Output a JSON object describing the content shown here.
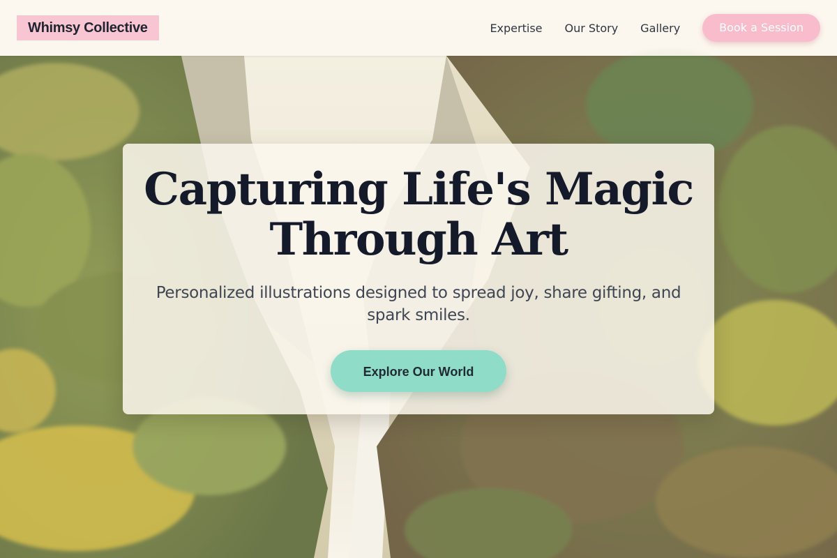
{
  "header": {
    "brand": "Whimsy Collective",
    "nav": [
      {
        "label": "Expertise"
      },
      {
        "label": "Our Story"
      },
      {
        "label": "Gallery"
      }
    ],
    "book_button": "Book a Session"
  },
  "hero": {
    "title_line1": "Capturing Life's Magic",
    "title_line2": "Through Art",
    "subtitle": "Personalized illustrations designed to spread joy, share gifting, and spark smiles.",
    "cta": "Explore Our World",
    "background": "painted-waterfall-forest-image"
  },
  "colors": {
    "brand_bg": "#f8c6d3",
    "book_button_bg": "#f9bccc",
    "explore_button_bg": "#8fdcc8",
    "title_text": "#141a2a"
  }
}
